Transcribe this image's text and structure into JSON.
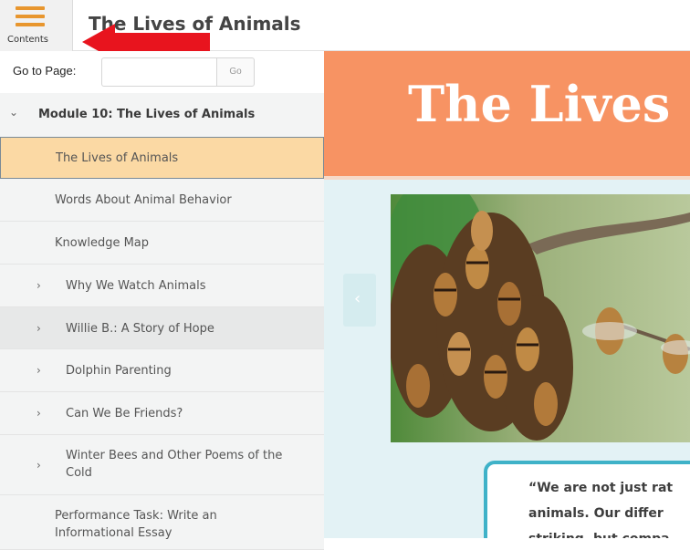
{
  "topbar": {
    "contents_label": "Contents",
    "book_title": "The Lives of Animals"
  },
  "sidebar": {
    "goto_label": "Go to Page:",
    "goto_placeholder": "",
    "goto_button": "Go",
    "module": {
      "chevron": "⌄",
      "title": "Module 10: The Lives of Animals"
    },
    "items": [
      {
        "label": "The Lives of Animals",
        "state": "selected"
      },
      {
        "label": "Words About Animal Behavior"
      },
      {
        "label": "Knowledge Map"
      },
      {
        "label": "Why We Watch Animals",
        "chevron": "›"
      },
      {
        "label": "Willie B.: A Story of Hope",
        "chevron": "›",
        "state": "hover"
      },
      {
        "label": "Dolphin Parenting",
        "chevron": "›"
      },
      {
        "label": "Can We Be Friends?",
        "chevron": "›"
      },
      {
        "label": "Winter Bees and Other Poems of the Cold",
        "chevron": "›"
      },
      {
        "label": "Performance Task: Write an Informational Essay"
      }
    ]
  },
  "main": {
    "banner_title": "The Lives",
    "prev_icon": "‹",
    "quote_lines": [
      "“We are not just rat",
      "animals. Our differ",
      "striking, but compa"
    ]
  },
  "colors": {
    "accent_orange": "#f79363",
    "hamburger": "#e8962e",
    "selected_bg": "#fbd9a4",
    "quote_border": "#3fb2c8",
    "content_bg": "#e3f2f5",
    "annotation_arrow": "#e8141e"
  },
  "icons": {
    "menu": "hamburger-icon",
    "annotation": "red-arrow-icon",
    "prev": "chevron-left-icon"
  }
}
